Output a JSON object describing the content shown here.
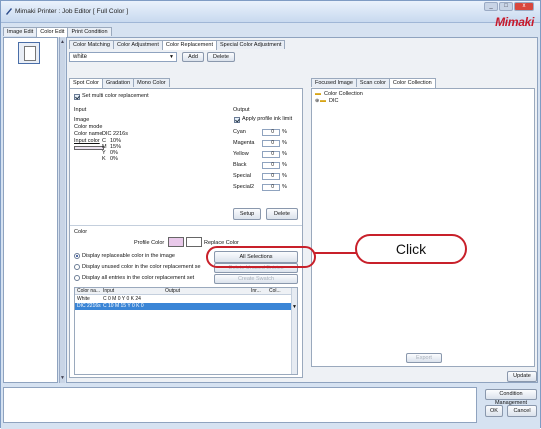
{
  "window": {
    "title": "Mimaki Printer : Job Editor [ Full Color ]",
    "brand": "Mimaki",
    "min": "_",
    "max": "□",
    "close": "x"
  },
  "left_tabs": [
    "Image Edit",
    "Color Edit",
    "Print Condition"
  ],
  "main_tabs": [
    "Color Matching",
    "Color Adjustment",
    "Color Replacement",
    "Special Color Adjustment"
  ],
  "top": {
    "select_value": "white",
    "add_label": "Add",
    "delete_label": "Delete"
  },
  "sub_tabs": [
    "Spot Color",
    "Gradation",
    "Mono Color"
  ],
  "spot": {
    "multi_label": "Set multi color replacement",
    "input_header": "Input",
    "output_header": "Output",
    "image_label": "Image",
    "color_mode_label": "Color mode",
    "color_name_label": "Color name",
    "color_name_value": "DIC 2216s",
    "input_color_label": "Input color",
    "channels": [
      {
        "k": "C",
        "v": "10%"
      },
      {
        "k": "M",
        "v": "15%"
      },
      {
        "k": "Y",
        "v": "0%"
      },
      {
        "k": "K",
        "v": "0%"
      }
    ],
    "apply_limit_label": "Apply profile ink limit",
    "outputs": [
      {
        "k": "Cyan",
        "v": "0"
      },
      {
        "k": "Magenta",
        "v": "0"
      },
      {
        "k": "Yellow",
        "v": "0"
      },
      {
        "k": "Black",
        "v": "0"
      },
      {
        "k": "Special",
        "v": "0"
      },
      {
        "k": "Special2",
        "v": "0"
      }
    ],
    "pct": "%",
    "setup_label": "Setup",
    "delete_label": "Delete"
  },
  "color_section": {
    "header": "Color",
    "profile_color_label": "Profile Color",
    "replace_color_label": "Replace Color",
    "radios": [
      "Display replaceable color in the image",
      "Display unused color in the color replacement se",
      "Display all entries in the color replacement set"
    ],
    "all_selections_label": "All Selections",
    "unused_button_label": "Delete Unused Entries",
    "create_swatch_label": "Create Swatch",
    "table_headers": [
      "Color na...",
      "Input",
      "Output",
      "Inr...",
      "Col..."
    ],
    "rows": [
      {
        "name": "White",
        "input": "C 0 M 0 Y 0 K 24"
      },
      {
        "name": "DIC 2216s",
        "input": "C 10 M 15 Y 0 K 0"
      }
    ]
  },
  "right_tabs": [
    "Focused Image",
    "Scan color",
    "Color Collection"
  ],
  "tree": {
    "root": "Color Collection",
    "child": "DIC"
  },
  "export_label": "Export",
  "update_label": "Update",
  "callout_text": "Click",
  "bottom": {
    "condition_label": "Condition Management",
    "ok_label": "OK",
    "cancel_label": "Cancel"
  },
  "colors": {
    "profile_swatch": "#e9c9ea",
    "replace_swatch": "#ffffff",
    "selection": "#3a85d6",
    "callout": "#c8202a"
  }
}
